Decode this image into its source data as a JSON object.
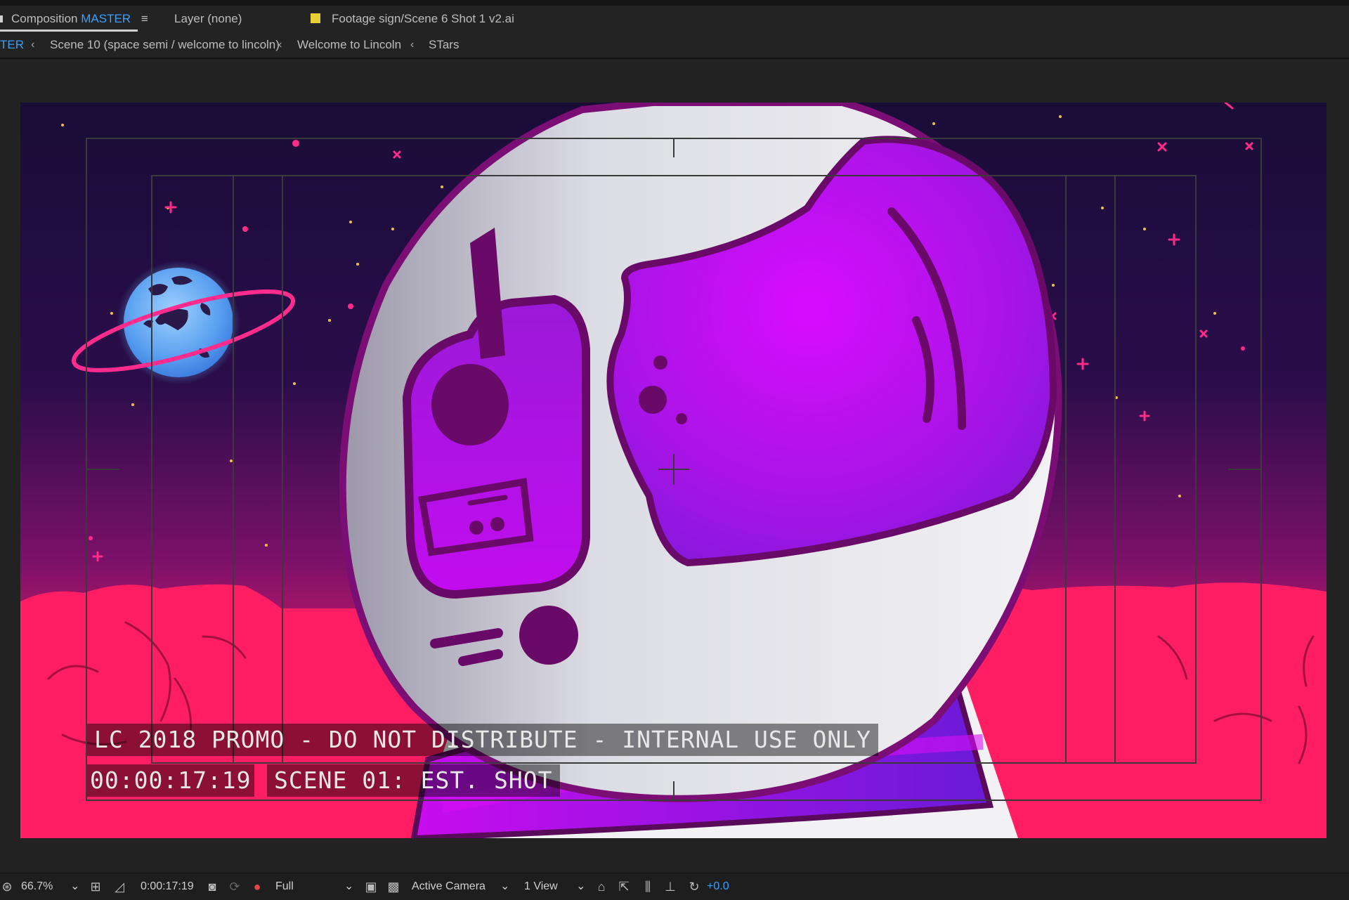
{
  "tabs": {
    "composition_prefix": "Composition",
    "composition_name": "MASTER",
    "layer": "Layer (none)",
    "footage": "Footage sign/Scene 6 Shot 1 v2.ai",
    "footage_swatch_color": "#e8cf36"
  },
  "breadcrumb": {
    "items": [
      "TER",
      "Scene 10 (space semi / welcome to lincoln)",
      "Welcome to Lincoln",
      "STars"
    ]
  },
  "viewer": {
    "burn_in_title": "LC 2018 PROMO - DO NOT DISTRIBUTE - INTERNAL USE ONLY",
    "burn_in_timecode": "00:00:17:19",
    "burn_in_scene": "SCENE 01: EST. SHOT"
  },
  "toolbar": {
    "zoom": "66.7%",
    "timecode": "0:00:17:19",
    "resolution": "Full",
    "camera": "Active Camera",
    "views": "1 View",
    "exposure": "+0.0"
  },
  "colors": {
    "accent": "#3aa0ff",
    "space_dark": "#190d38",
    "magenta": "#cc10f0",
    "ground": "#ff1e63"
  }
}
